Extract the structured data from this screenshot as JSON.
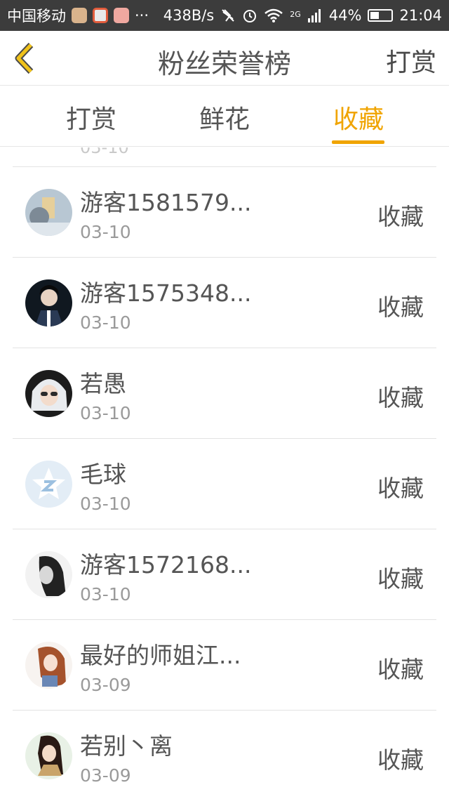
{
  "status_bar": {
    "carrier": "中国移动",
    "more": "···",
    "net_speed": "438B/s",
    "network": "2G",
    "battery": "44%",
    "battery_level": 0.44,
    "time": "21:04"
  },
  "nav": {
    "title": "粉丝荣誉榜",
    "action": "打赏"
  },
  "tabs": [
    {
      "label": "打赏"
    },
    {
      "label": "鲜花"
    },
    {
      "label": "收藏"
    }
  ],
  "active_tab": "收藏",
  "accent_color": "#f0a400",
  "partial_item": {
    "date": "03-10"
  },
  "items": [
    {
      "name": "游客1581579...",
      "date": "03-10",
      "type": "收藏"
    },
    {
      "name": "游客1575348...",
      "date": "03-10",
      "type": "收藏"
    },
    {
      "name": "若愚",
      "date": "03-10",
      "type": "收藏"
    },
    {
      "name": "毛球",
      "date": "03-10",
      "type": "收藏"
    },
    {
      "name": "游客1572168...",
      "date": "03-10",
      "type": "收藏"
    },
    {
      "name": "最好的师姐江...",
      "date": "03-09",
      "type": "收藏"
    },
    {
      "name": "若别丶离",
      "date": "03-09",
      "type": "收藏"
    }
  ]
}
